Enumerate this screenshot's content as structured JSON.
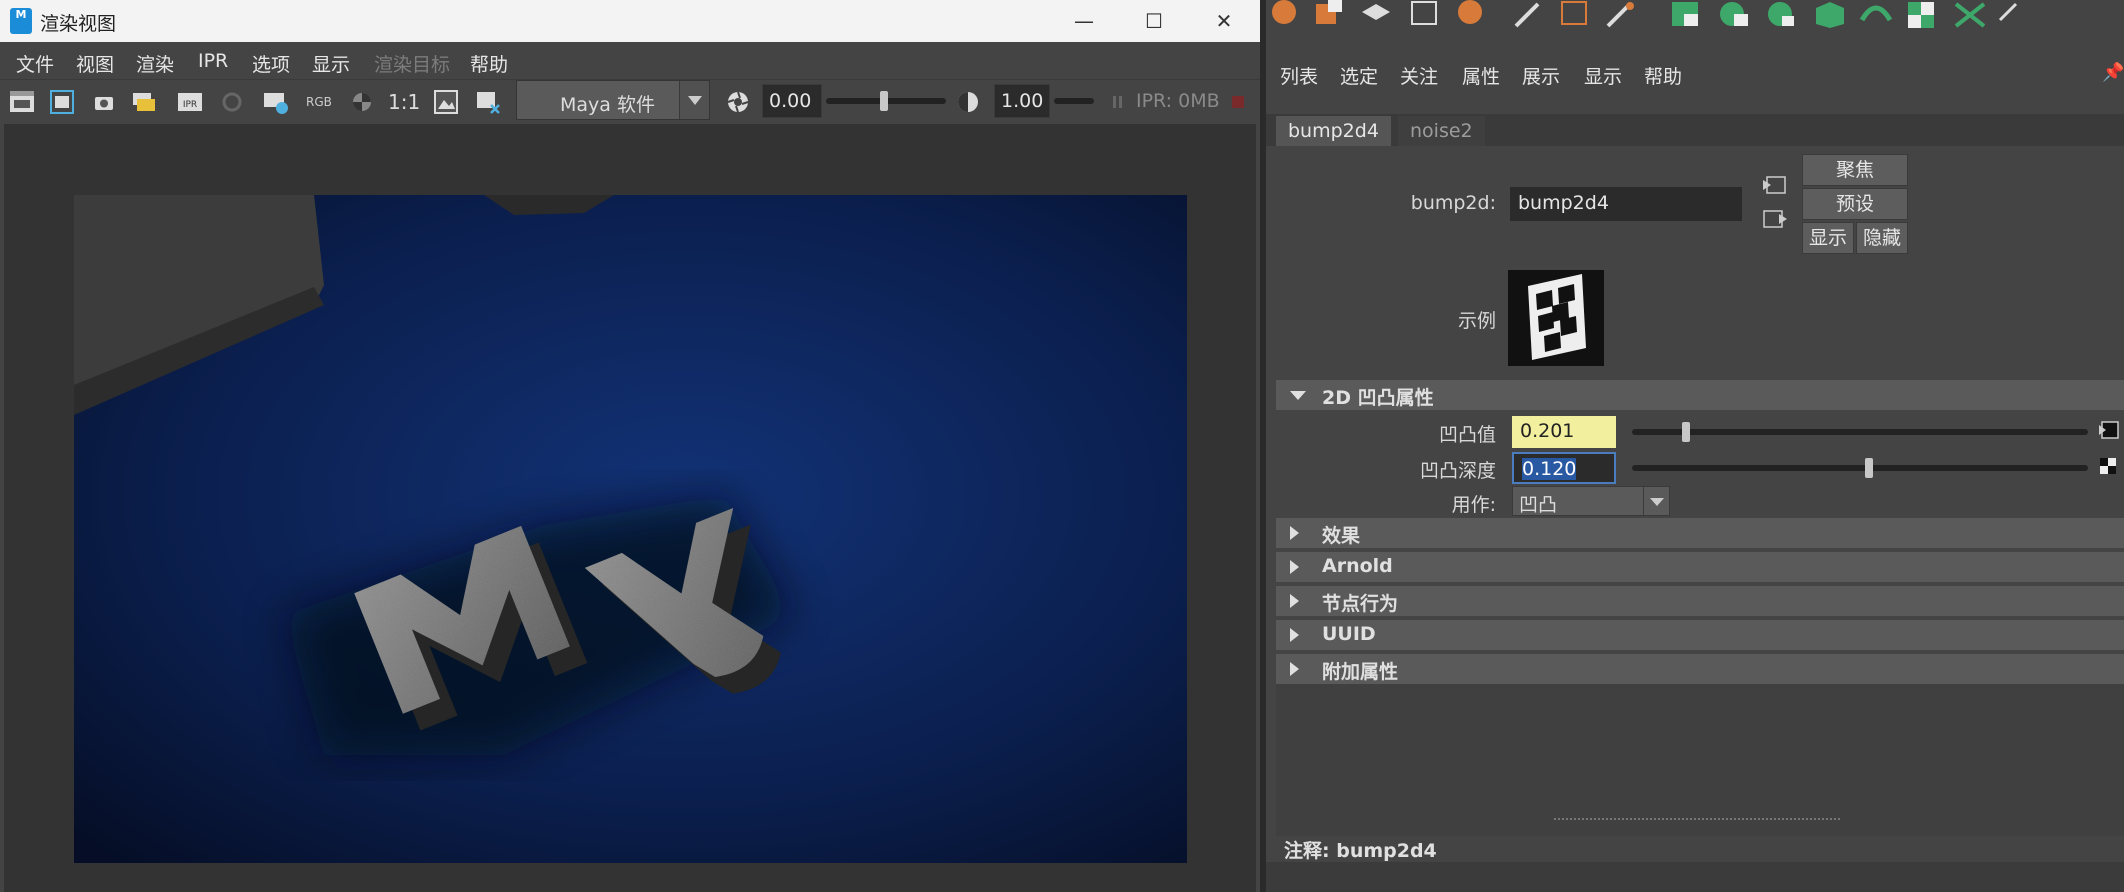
{
  "window": {
    "title": "渲染视图",
    "app_icon_text": "M",
    "minimize": "—",
    "maximize": "☐",
    "close": "✕"
  },
  "menubar": [
    {
      "label": "文件",
      "enabled": true
    },
    {
      "label": "视图",
      "enabled": true
    },
    {
      "label": "渲染",
      "enabled": true
    },
    {
      "label": "IPR",
      "enabled": true
    },
    {
      "label": "选项",
      "enabled": true
    },
    {
      "label": "显示",
      "enabled": true
    },
    {
      "label": "渲染目标",
      "enabled": false
    },
    {
      "label": "帮助",
      "enabled": true
    }
  ],
  "toolbar": {
    "rgb_label": "RGB",
    "ratio_label": "1:1",
    "renderer": "Maya 软件",
    "exposure": "0.00",
    "gamma": "1.00",
    "ipr_status": "IPR: 0MB"
  },
  "attribute_editor": {
    "menubar": [
      "列表",
      "选定",
      "关注",
      "属性",
      "展示",
      "显示",
      "帮助"
    ],
    "tabs": [
      {
        "label": "bump2d4",
        "active": true
      },
      {
        "label": "noise2",
        "active": false
      }
    ],
    "node_type_label": "bump2d:",
    "node_name": "bump2d4",
    "buttons": {
      "focus": "聚焦",
      "presets": "预设",
      "show": "显示",
      "hide": "隐藏"
    },
    "sample_label": "示例",
    "sections": {
      "bump_2d": "2D 凹凸属性",
      "collapsed": [
        "效果",
        "Arnold",
        "节点行为",
        "UUID",
        "附加属性"
      ]
    },
    "attributes": {
      "bump_value_label": "凹凸值",
      "bump_value": "0.201",
      "bump_value_slider": 0.11,
      "bump_depth_label": "凹凸深度",
      "bump_depth": "0.120",
      "bump_depth_slider": 0.51,
      "use_as_label": "用作:",
      "use_as": "凹凸"
    },
    "notes_label": "注释:  bump2d4"
  },
  "render_text": "MY",
  "colors": {
    "accent_selection": "#2a59a3",
    "keyed_field": "#f2f09e",
    "render_bg": "#0d2556"
  }
}
